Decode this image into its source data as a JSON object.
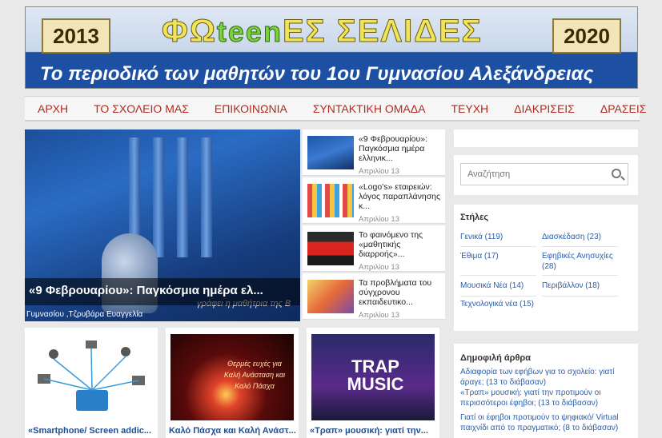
{
  "banner": {
    "year_left": "2013",
    "year_right": "2020",
    "title_a": "ΦΩ",
    "title_teen": "teen",
    "title_b": "ΕΣ ΣΕΛΙΔΕΣ",
    "subtitle": "Το περιοδικό των μαθητών του 1ου Γυμνασίου Αλεξάνδρειας"
  },
  "nav": [
    "ΑΡΧΗ",
    "ΤΟ ΣΧΟΛΕΙΟ ΜΑΣ",
    "ΕΠΙΚΟΙΝΩΝΙΑ",
    "ΣΥΝΤΑΚΤΙΚΗ ΟΜΑΔΑ",
    "ΤΕΥΧΗ",
    "ΔΙΑΚΡΙΣΕΙΣ",
    "ΔΡΑΣΕΙΣ"
  ],
  "slider": {
    "caption": "«9 Φεβρουαρίου»: Παγκόσμια ημέρα ελ...",
    "sub": "Γυμνασίου ,Τζρυβάρα Ευαγγελία",
    "art_text": "γράφει η μαθήτρια της Β"
  },
  "side_articles": [
    {
      "title": "«9 Φεβρουαρίου»: Παγκόσμια ημέρα ελληνικ...",
      "date": "Απριλίου 13"
    },
    {
      "title": "«Logo's» εταιρειών: λόγος παραπλάνησης κ...",
      "date": "Απριλίου 13"
    },
    {
      "title": "Το φαινόμενο της «μαθητικής διαρροής»...",
      "date": "Απριλίου 13"
    },
    {
      "title": "Τα προβλήματα του σύγχρονου εκπαιδευτικο...",
      "date": "Απριλίου 13"
    }
  ],
  "cards": [
    {
      "title": "«Smartphone/ Screen addic..."
    },
    {
      "title": "Καλό Πάσχα και Καλή Ανάστ..."
    },
    {
      "title": "«Τραπ» μουσική: γιατί την..."
    }
  ],
  "card_texts": {
    "easter": "Θερμές ευχές για Καλή Ανάσταση και Καλό Πάσχα",
    "trap": "TRAP MUSIC"
  },
  "search": {
    "placeholder": "Αναζήτηση"
  },
  "categories": {
    "heading": "Στήλες",
    "items": [
      "Γενικά (119)",
      "Διασκέδαση (23)",
      "Έθιμα (17)",
      "Εφηβικές Ανησυχίες (28)",
      "Μουσικά Νέα (14)",
      "Περιβάλλον (18)",
      "Τεχνολογικά νέα (15)"
    ]
  },
  "popular": {
    "heading": "Δημοφιλή άρθρα",
    "items": [
      "Αδιαφορία των εφήβων για το σχολείο: γιατί άραγε; (13 το διάβασαν)",
      "«Τραπ» μουσική: γιατί την προτιμούν οι περισσότεροι έφηβοι; (13 το διάβασαν)",
      "Γιατί οι έφηβοι προτιμούν το ψηφιακό/ Virtual παιχνίδι από το πραγματικό; (8 το διάβασαν)"
    ]
  },
  "colors": {
    "nav_text": "#b02b1f",
    "link": "#2b5ea8"
  }
}
